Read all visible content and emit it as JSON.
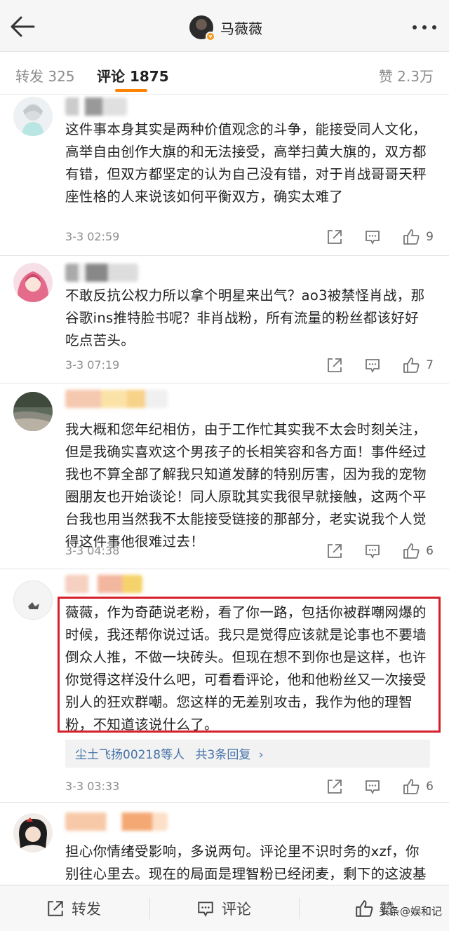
{
  "header": {
    "title": "马薇薇",
    "verified_badge": "v"
  },
  "tabs": {
    "repost": "转发 325",
    "comment": "评论 1875",
    "like": "赞 2.3万"
  },
  "comments": [
    {
      "text": "这件事本身其实是两种价值观念的斗争，能接受同人文化，高举自由创作大旗的和无法接受，高举扫黄大旗的，双方都有错，但双方都坚定的认为自己没有错，对于肖战哥哥天秤座性格的人来说该如何平衡双方，确实太难了",
      "time": "3-3 02:59",
      "likes": "9"
    },
    {
      "text": "不敢反抗公权力所以拿个明星来出气？ao3被禁怪肖战，那谷歌ins推特脸书呢？非肖战粉，所有流量的粉丝都该好好吃点苦头。",
      "time": "3-3 07:19",
      "likes": "7"
    },
    {
      "text": "我大概和您年纪相仿，由于工作忙其实我不太会时刻关注，但是我确实喜欢这个男孩子的长相笑容和各方面！事件经过我也不算全部了解我只知道发酵的特别厉害，因为我的宠物圈朋友也开始谈论！同人原耽其实我很早就接触，这两个平台我也用当然我不太能接受链接的那部分，老实说我个人觉得这件事他很难过去！",
      "time": "3-3 04:38",
      "likes": "6"
    },
    {
      "text": "薇薇，作为奇葩说老粉，看了你一路，包括你被群嘲网爆的时候，我还帮你说过话。我只是觉得应该就是论事也不要墙倒众人推，不做一块砖头。但现在想不到你也是这样，也许你觉得这样没什么吧，可看看评论，他和他粉丝又一次接受别人的狂欢群嘲。您这样的无差别攻击，我作为他的理智粉，不知道该说什么了。",
      "time": "3-3 03:33",
      "likes": "6",
      "reply_user": "尘土飞扬00218",
      "reply_suffix": "等人",
      "reply_count": "共3条回复",
      "reply_arrow": "›"
    },
    {
      "text": "担心你情绪受影响，多说两句。评论里不识时务的xzf，你别往心里去。现在的局面是理智粉已经闭麦，剩下的这波基本上也是之前路偶像于不义（局面）的同"
    }
  ],
  "bottom_bar": {
    "repost": "转发",
    "comment": "评论",
    "like": "赞"
  },
  "watermark": "头条@娱和记",
  "colors": {
    "accent": "#ff8200",
    "highlight_border": "#d51f2b",
    "link": "#4673a8"
  },
  "icons": {
    "back": "back-arrow-icon",
    "more": "more-dots-icon",
    "share": "share-icon",
    "comment": "comment-icon",
    "like": "thumbs-up-icon"
  }
}
